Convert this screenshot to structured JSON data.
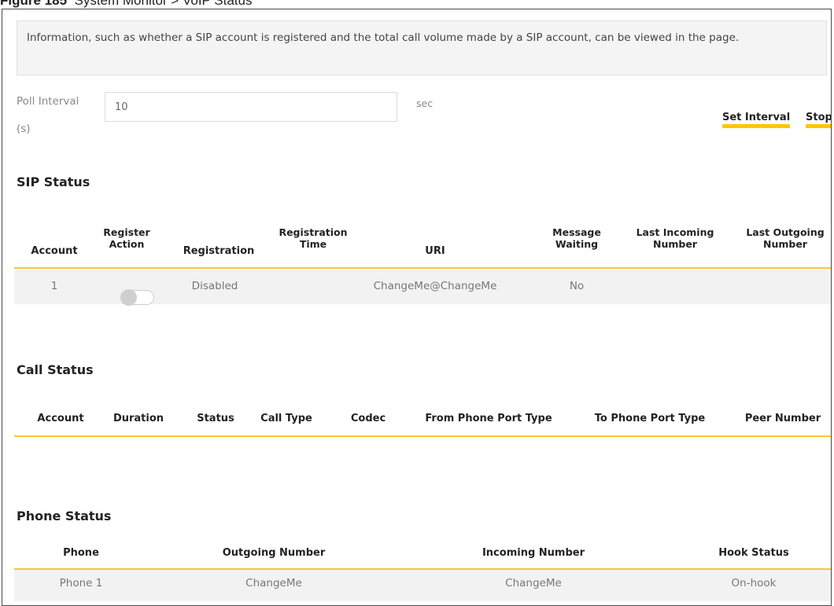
{
  "caption": {
    "figure": "Figure 185",
    "title": "System Monitor > VoIP Status"
  },
  "info": "Information, such as whether a SIP account is registered and the total call volume made by a SIP account, can be viewed in the page.",
  "poll": {
    "label_line1": "Poll Interval",
    "label_line2": "(s)",
    "value": "10",
    "unit": "sec",
    "set_interval": "Set Interval",
    "stop": "Stop"
  },
  "sip_status": {
    "title": "SIP Status",
    "columns": [
      "Account",
      "Register Action",
      "Registration",
      "Registration Time",
      "URI",
      "Message Waiting",
      "Last Incoming Number",
      "Last Outgoing Number"
    ],
    "rows": [
      {
        "account": "1",
        "register_action": "off",
        "registration": "Disabled",
        "registration_time": "",
        "uri": "ChangeMe@ChangeMe",
        "message_waiting": "No",
        "last_incoming": "",
        "last_outgoing": ""
      }
    ]
  },
  "call_status": {
    "title": "Call Status",
    "columns": [
      "Account",
      "Duration",
      "Status",
      "Call Type",
      "Codec",
      "From Phone Port Type",
      "To Phone Port Type",
      "Peer Number"
    ],
    "rows": []
  },
  "phone_status": {
    "title": "Phone Status",
    "columns": [
      "Phone",
      "Outgoing Number",
      "Incoming Number",
      "Hook Status"
    ],
    "rows": [
      {
        "phone": "Phone 1",
        "outgoing": "ChangeMe",
        "incoming": "ChangeMe",
        "hook": "On-hook"
      }
    ]
  },
  "colors": {
    "accent": "#ffc600",
    "divider": "#f7c63a",
    "row_bg": "#f2f2f2"
  }
}
